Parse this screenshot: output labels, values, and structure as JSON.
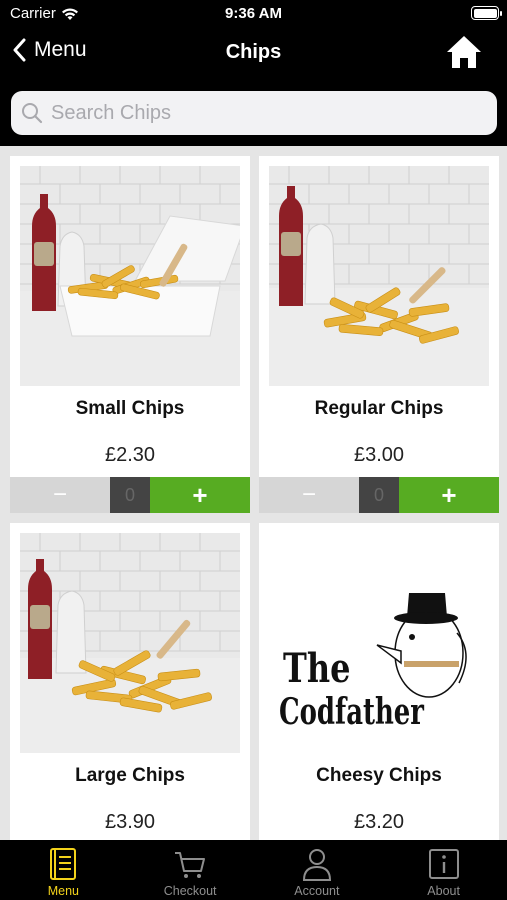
{
  "status_bar": {
    "carrier": "Carrier",
    "time": "9:36 AM"
  },
  "nav": {
    "back_label": "Menu",
    "title": "Chips"
  },
  "search": {
    "placeholder": "Search Chips",
    "value": ""
  },
  "products": [
    {
      "name": "Small Chips",
      "price": "£2.30",
      "quantity": "0",
      "image": "small-chips-photo"
    },
    {
      "name": "Regular Chips",
      "price": "£3.00",
      "quantity": "0",
      "image": "regular-chips-photo"
    },
    {
      "name": "Large Chips",
      "price": "£3.90",
      "image": "large-chips-photo"
    },
    {
      "name": "Cheesy Chips",
      "price": "£3.20",
      "image": "codfather-logo"
    }
  ],
  "qty_controls": {
    "minus": "−",
    "plus": "+"
  },
  "logo": {
    "line1": "The",
    "line2": "Codfather"
  },
  "tabs": [
    {
      "label": "Menu",
      "icon": "menu-icon",
      "active": true
    },
    {
      "label": "Checkout",
      "icon": "cart-icon",
      "active": false
    },
    {
      "label": "Account",
      "icon": "person-icon",
      "active": false
    },
    {
      "label": "About",
      "icon": "info-icon",
      "active": false
    }
  ],
  "colors": {
    "accent_green": "#57ac22",
    "active_tab": "#f2d21b",
    "background": "#000000",
    "content_bg": "#e5e5e5"
  }
}
